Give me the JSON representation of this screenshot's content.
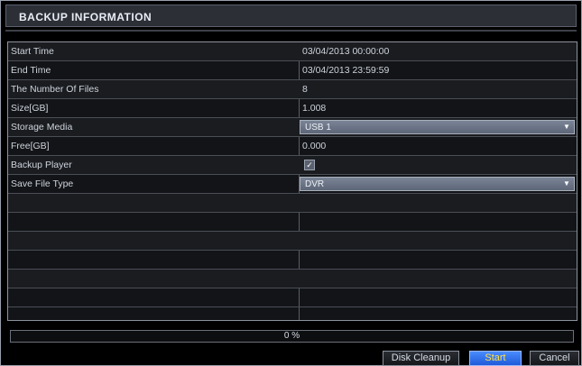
{
  "dialog": {
    "title": "BACKUP INFORMATION"
  },
  "rows": [
    {
      "label": "Start Time",
      "value": "03/04/2013 00:00:00"
    },
    {
      "label": "End Time",
      "value": "03/04/2013 23:59:59"
    },
    {
      "label": "The Number Of Files",
      "value": "8"
    },
    {
      "label": "Size[GB]",
      "value": "1.008"
    },
    {
      "label": "Storage Media",
      "value": "USB 1"
    },
    {
      "label": "Free[GB]",
      "value": "0.000"
    },
    {
      "label": "Backup Player",
      "value": "checked"
    },
    {
      "label": "Save File Type",
      "value": "DVR"
    }
  ],
  "progress": {
    "text": "0 %",
    "percent": 0
  },
  "buttons": {
    "disk_cleanup": "Disk Cleanup",
    "start": "Start",
    "cancel": "Cancel"
  },
  "colors": {
    "accent": "#1f5ad8",
    "start_text": "#ffe24a"
  }
}
